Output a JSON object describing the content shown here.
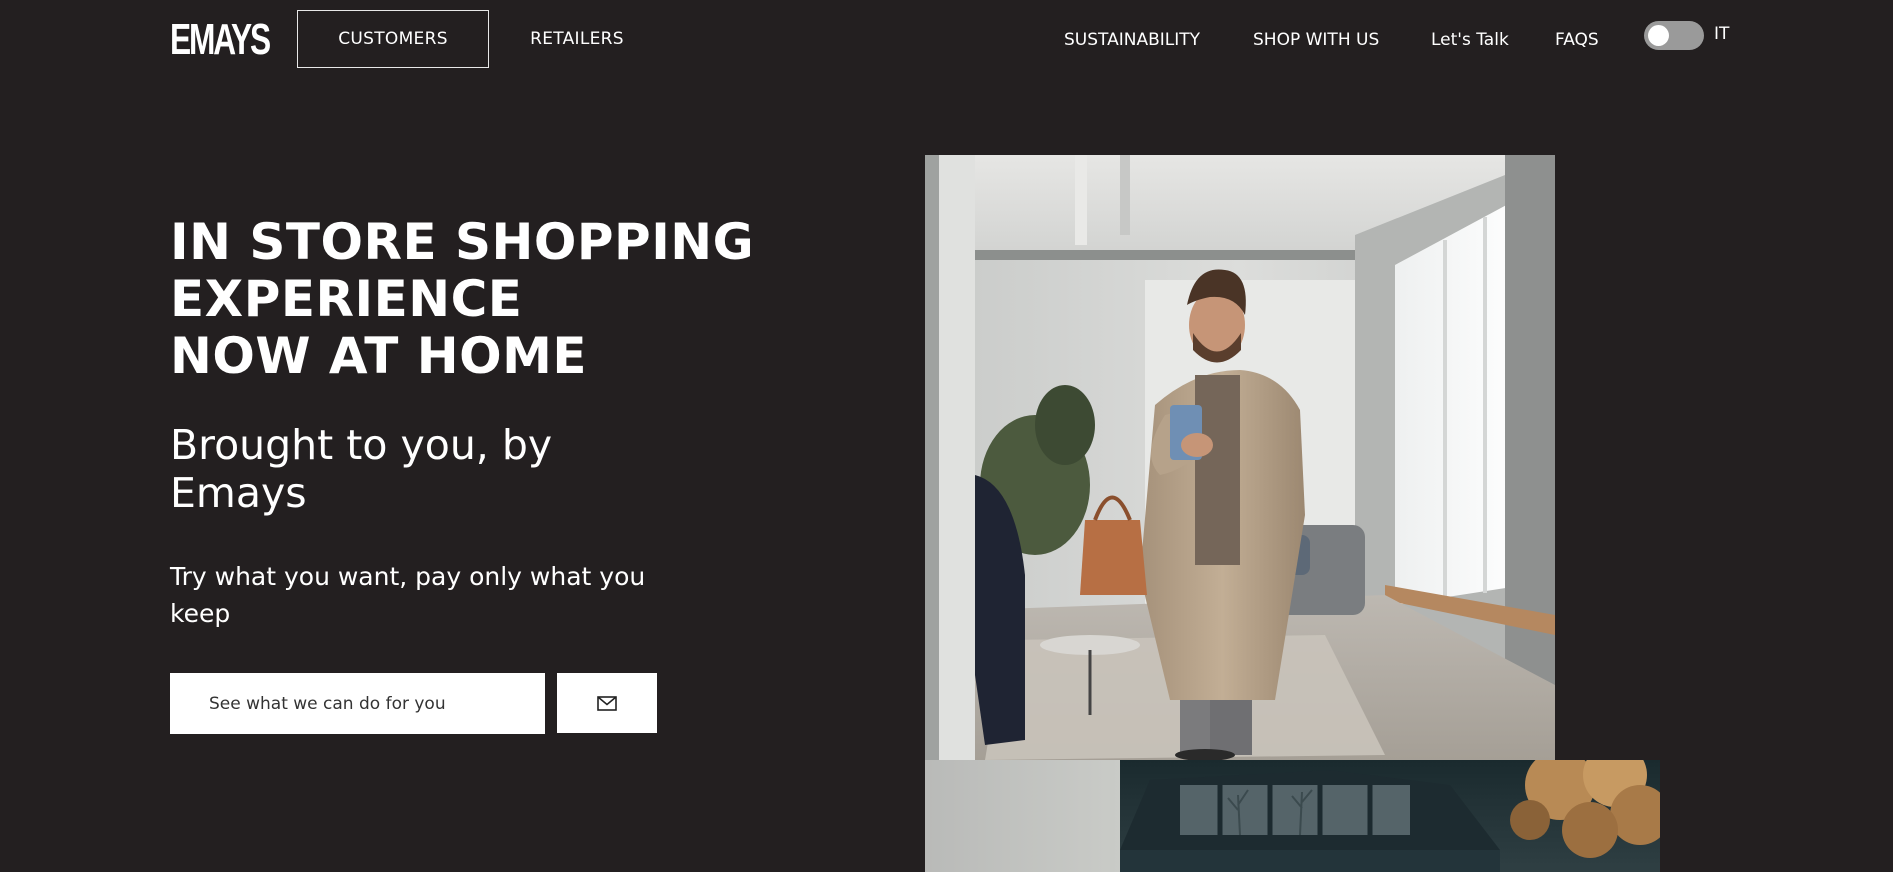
{
  "header": {
    "logo": "EMAYS",
    "tabs": [
      {
        "label": "CUSTOMERS",
        "active": true
      },
      {
        "label": "RETAILERS",
        "active": false
      }
    ],
    "nav": [
      {
        "label": "SUSTAINABILITY"
      },
      {
        "label": "SHOP WITH US"
      },
      {
        "label": "Let's Talk"
      },
      {
        "label": "FAQS"
      }
    ],
    "language_toggle": {
      "label": "IT",
      "on": false
    }
  },
  "hero": {
    "title_lines": [
      "IN STORE SHOPPING",
      "EXPERIENCE",
      "NOW AT HOME"
    ],
    "subtitle": "Brought to you, by Emays",
    "description": "Try what you want, pay only what you keep",
    "cta": {
      "placeholder": "See what we can do for you",
      "button_icon": "mail-icon"
    }
  },
  "colors": {
    "background": "#231f20",
    "text": "#ffffff",
    "input_bg": "#ffffff",
    "toggle_track": "#9a9a9a"
  }
}
